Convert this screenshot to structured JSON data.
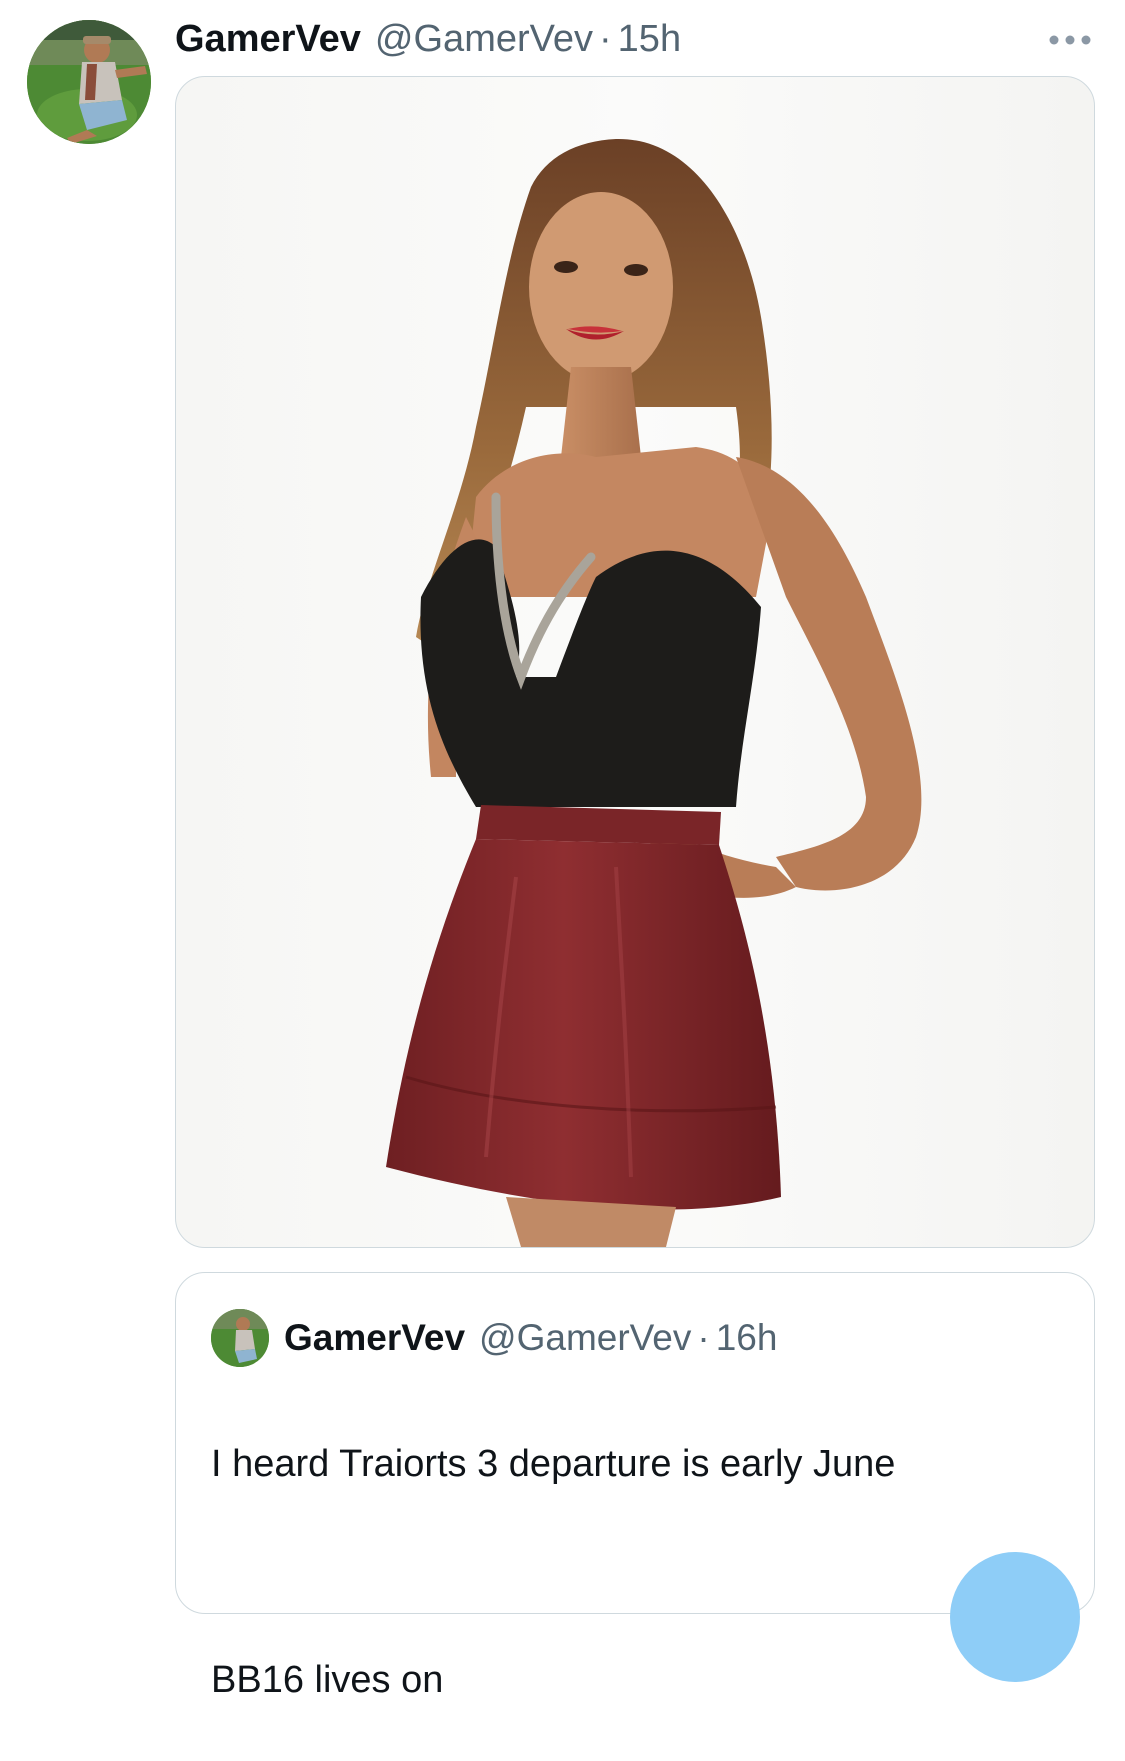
{
  "tweet": {
    "display_name": "GamerVev",
    "handle": "@GamerVev",
    "separator": "·",
    "time": "15h",
    "more_icon": "more-horizontal-icon",
    "media_alt": "photo"
  },
  "quoted_tweet": {
    "display_name": "GamerVev",
    "handle": "@GamerVev",
    "separator": "·",
    "time": "16h",
    "text_line1": "I heard Traiorts 3 departure is early June",
    "text_line2": "BB16 lives on"
  },
  "colors": {
    "text_primary": "#0f1419",
    "text_secondary": "#536471",
    "border": "#cfd9de",
    "accent": "#1d9bf0"
  }
}
